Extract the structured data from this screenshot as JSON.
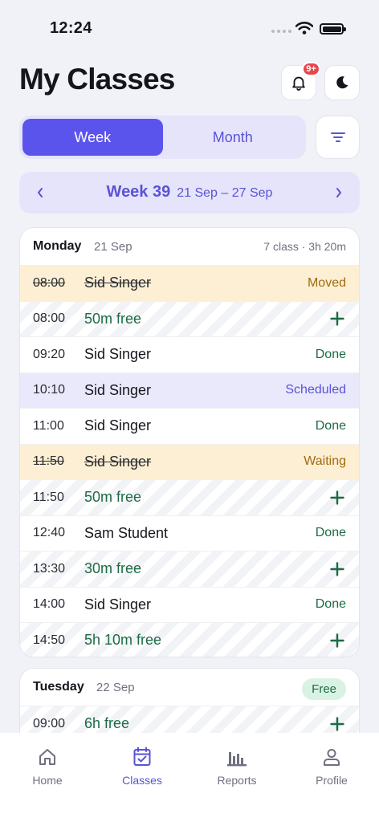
{
  "status_bar": {
    "time": "12:24"
  },
  "header": {
    "title": "My Classes",
    "notification_badge": "9+",
    "icons": {
      "notifications": "bell-icon",
      "theme": "moon-icon",
      "filter": "filter-icon"
    }
  },
  "view_toggle": {
    "week_label": "Week",
    "month_label": "Month",
    "selected": "Week"
  },
  "week_nav": {
    "label": "Week 39",
    "range": "21 Sep – 27 Sep"
  },
  "colors": {
    "accent": "#5b54ec",
    "moved_bg": "#fcefd3",
    "scheduled_bg": "#eae9fb",
    "done_text": "#1d6b45",
    "moved_text": "#a26a11"
  },
  "days": [
    {
      "name": "Monday",
      "date": "21 Sep",
      "summary": "7 class · 3h 20m",
      "slots": [
        {
          "time": "08:00",
          "title": "Sid Singer",
          "status": "Moved",
          "kind": "moved"
        },
        {
          "time": "08:00",
          "title": "50m free",
          "status": "",
          "kind": "free"
        },
        {
          "time": "09:20",
          "title": "Sid Singer",
          "status": "Done",
          "kind": "done"
        },
        {
          "time": "10:10",
          "title": "Sid Singer",
          "status": "Scheduled",
          "kind": "scheduled"
        },
        {
          "time": "11:00",
          "title": "Sid Singer",
          "status": "Done",
          "kind": "done"
        },
        {
          "time": "11:50",
          "title": "Sid Singer",
          "status": "Waiting",
          "kind": "moved"
        },
        {
          "time": "11:50",
          "title": "50m free",
          "status": "",
          "kind": "free"
        },
        {
          "time": "12:40",
          "title": "Sam Student",
          "status": "Done",
          "kind": "done"
        },
        {
          "time": "13:30",
          "title": "30m free",
          "status": "",
          "kind": "free"
        },
        {
          "time": "14:00",
          "title": "Sid Singer",
          "status": "Done",
          "kind": "done"
        },
        {
          "time": "14:50",
          "title": "5h 10m free",
          "status": "",
          "kind": "free"
        }
      ]
    },
    {
      "name": "Tuesday",
      "date": "22 Sep",
      "badge": "Free",
      "slots": [
        {
          "time": "09:00",
          "title": "6h free",
          "status": "",
          "kind": "free"
        }
      ]
    }
  ],
  "tab_bar": {
    "tabs": [
      {
        "label": "Home",
        "icon": "home-icon"
      },
      {
        "label": "Classes",
        "icon": "calendar-check-icon",
        "active": true
      },
      {
        "label": "Reports",
        "icon": "bar-chart-icon"
      },
      {
        "label": "Profile",
        "icon": "user-icon"
      }
    ]
  }
}
